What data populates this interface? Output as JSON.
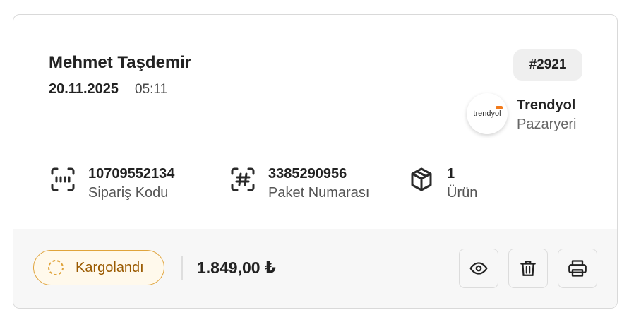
{
  "order": {
    "customer_name": "Mehmet Taşdemir",
    "date": "20.11.2025",
    "time": "05:11",
    "number": "#2921"
  },
  "store": {
    "logo_text": "trendyol",
    "name": "Trendyol",
    "subtitle": "Pazaryeri",
    "accent_color": "#f27a1a"
  },
  "details": [
    {
      "value": "10709552134",
      "label": "Sipariş Kodu",
      "icon": "barcode-scan-icon"
    },
    {
      "value": "3385290956",
      "label": "Paket Numarası",
      "icon": "hash-scan-icon"
    },
    {
      "value": "1",
      "label": "Ürün",
      "icon": "package-box-icon"
    }
  ],
  "footer": {
    "status_label": "Kargolandı",
    "status_color": "#e0a43c",
    "total": "1.849,00 ₺",
    "actions": [
      "eye-icon",
      "trash-icon",
      "printer-icon"
    ]
  }
}
